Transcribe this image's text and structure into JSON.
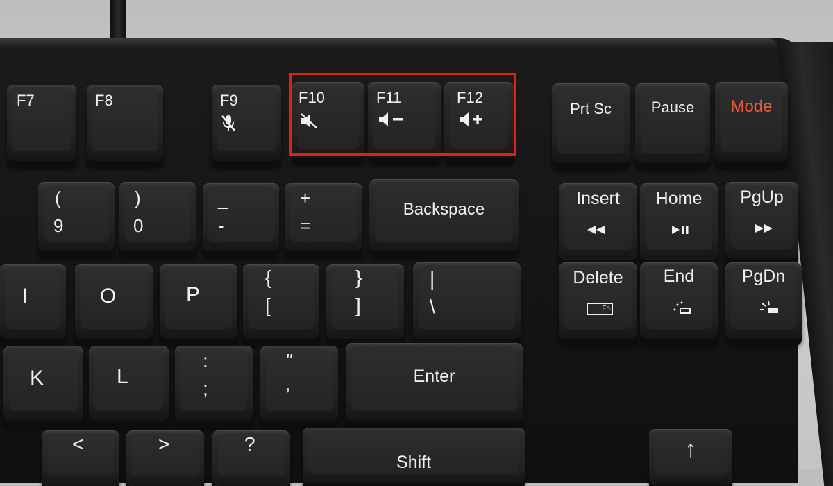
{
  "function_row": {
    "f7": "F7",
    "f8": "F8",
    "f9": "F9",
    "f10": "F10",
    "f11": "F11",
    "f12": "F12",
    "prtsc": "Prt Sc",
    "pause": "Pause",
    "mode": "Mode"
  },
  "number_row": {
    "k9_top": "(",
    "k9_bottom": "9",
    "k0_top": ")",
    "k0_bottom": "0",
    "minus_top": "_",
    "minus_bottom": "-",
    "equal_top": "+",
    "equal_bottom": "=",
    "backspace": "Backspace"
  },
  "nav_cluster": {
    "insert": "Insert",
    "home": "Home",
    "pgup": "PgUp",
    "delete": "Delete",
    "end": "End",
    "pgdn": "PgDn",
    "fn_label": "Fn"
  },
  "top_letter_row": {
    "i": "I",
    "o": "O",
    "p": "P",
    "lbrace_top": "{",
    "lbrace_bottom": "[",
    "rbrace_top": "}",
    "rbrace_bottom": "]",
    "pipe_top": "|",
    "pipe_bottom": "\\"
  },
  "home_row": {
    "k": "K",
    "l": "L",
    "colon_top": ":",
    "colon_bottom": ";",
    "quote_top": "\"",
    "quote_bottom": ",",
    "enter": "Enter"
  },
  "bottom_row": {
    "lt": "<",
    "gt": ">",
    "question": "?",
    "shift": "Shift",
    "up_arrow": "↑"
  },
  "media_icons": {
    "f9": "mic-mute-icon",
    "f10": "speaker-mute-icon",
    "f11": "volume-down-icon",
    "f12": "volume-up-icon",
    "insert": "rewind-icon",
    "home": "play-pause-icon",
    "pgup": "fast-forward-icon",
    "end": "brightness-down-icon",
    "pgdn": "brightness-up-icon"
  },
  "accent_color": "#e02020",
  "mode_color": "#ef5a3c"
}
